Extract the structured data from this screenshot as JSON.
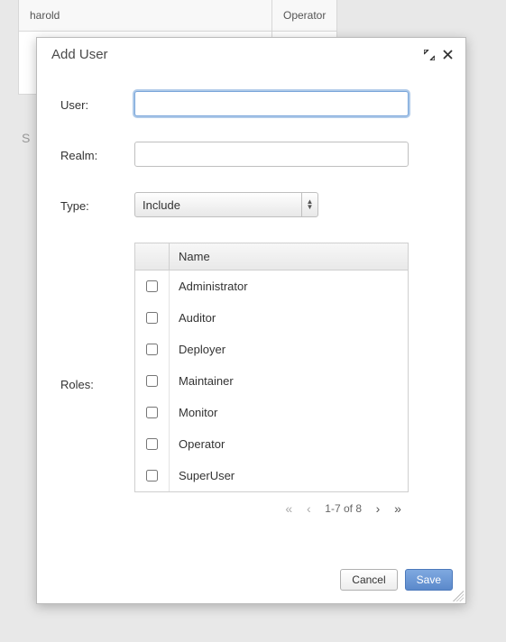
{
  "background": {
    "row1_col1": "harold",
    "row1_col2": "Operator",
    "sidebar_hint": "S"
  },
  "modal": {
    "title": "Add User",
    "labels": {
      "user": "User:",
      "realm": "Realm:",
      "type": "Type:",
      "roles": "Roles:"
    },
    "inputs": {
      "user_value": "",
      "realm_value": ""
    },
    "type_select": {
      "selected": "Include"
    },
    "roles": {
      "header": "Name",
      "items": [
        {
          "label": "Administrator",
          "checked": false
        },
        {
          "label": "Auditor",
          "checked": false
        },
        {
          "label": "Deployer",
          "checked": false
        },
        {
          "label": "Maintainer",
          "checked": false
        },
        {
          "label": "Monitor",
          "checked": false
        },
        {
          "label": "Operator",
          "checked": false
        },
        {
          "label": "SuperUser",
          "checked": false
        }
      ],
      "pager": "1-7 of 8"
    },
    "buttons": {
      "cancel": "Cancel",
      "save": "Save"
    }
  }
}
